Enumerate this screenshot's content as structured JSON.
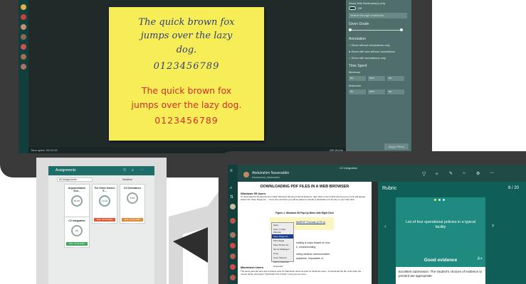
{
  "top_screen": {
    "note": {
      "line1": "The quick brown fox",
      "line2": "jumps over the lazy",
      "line3": "dog.",
      "line4": "0123456789",
      "line5": "The quick brown fox",
      "line6": "jumps over the lazy dog.",
      "line7": "0123456789"
    },
    "panel": {
      "show_bookmarked": "Show With Bookmark(s) only",
      "toggle_state": "Off",
      "search_placeholder": "Search through comments...",
      "given_grade": "Given Grade",
      "annotation": "Annotation",
      "radio1": "Show without annotations only",
      "radio2": "Show with and without annotations",
      "radio3": "Show with annotations only",
      "time_spent": "Time Spent",
      "minimum": "Minimum",
      "maximum": "Maximum",
      "hh": "hh",
      "mm": "mm",
      "ss": "ss",
      "apply": "Apply Filters"
    },
    "status_left": "Time spent: 00:10:15",
    "status_right": "299 Words"
  },
  "tablet": {
    "title": "Assignments",
    "filter": "All Assignments",
    "sort": "Deadline",
    "cards": [
      {
        "title": "Argumentative Ess...",
        "pct": "53.3%",
        "due": "Due: 14.02.2019 01:01",
        "color": "#e05a3a"
      },
      {
        "title": "The Silver Sword: E...",
        "pct": "71.1%",
        "due": "Due: 14.02.2019 21:01",
        "color": "#e05a3a"
      },
      {
        "title": "C2 Derivatives",
        "pct": "5.6%",
        "due": "Due: 14.02.2019 01:01",
        "color": "#e08a3a"
      },
      {
        "title": "C2 Integration",
        "pct": "0%",
        "due": "Due: 14.02.2019 00:10",
        "color": "#3ea85a"
      }
    ]
  },
  "bottom_screen": {
    "app_title": "C2 Integration",
    "student_name": "Abdulrahim Naseraddin",
    "student_sub": "Assessment_Naseraddin",
    "doc": {
      "heading": "DOWNLOADING PDF FILES IN A WEB BROWSER",
      "section1": "Windows 95 Users",
      "para1": "To download the file directly from within Windows 95 using Internet Explorer, right-click on the hotlink and a pop-up menu will appear. Select the \"Save Target As...\" menu item and then you will be asked to identify a destination for the file on your hard disk.",
      "figure": "Figure 1: Windows 95 Pop-Up Menu with Right Click",
      "link": "MaPDF Format (175 k)",
      "body2": "making a major impact on how",
      "body3": "e, communicating",
      "body4": "owing wireless communication -",
      "body5": "anywhere, impossible, in",
      "section2": "Macintosh Users",
      "para2": "The same general rules and functions exist for Macintosh users as exist for Windows users. To download the file, hold down the mouse button and select \"Download Link to Disk\" in the pop-up menu."
    },
    "context_menu": [
      "Open",
      "Open in New Window",
      "Save Target As...",
      "Print Target",
      "Save Picture As...",
      "Set as Wallpaper",
      "Copy",
      "Copy Shortcut",
      "Add to Favorites",
      "Properties"
    ],
    "rubric": {
      "title": "Rubric",
      "page": "8 / 20",
      "card_text": "List of four operational policies in a typical facility",
      "level": "Good evidence",
      "desc": "Excellent submission. The student's choices of evidence to present are appropriate"
    }
  }
}
